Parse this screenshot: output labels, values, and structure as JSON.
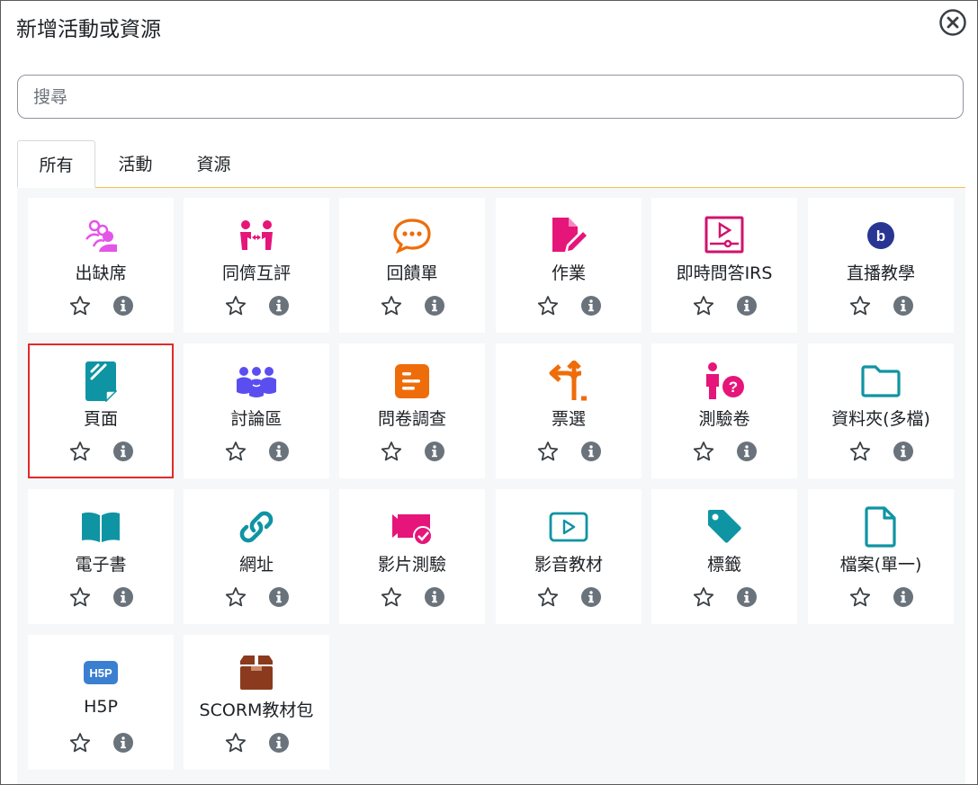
{
  "dialog": {
    "title": "新增活動或資源",
    "search_placeholder": "搜尋"
  },
  "tabs": [
    {
      "label": "所有",
      "active": true
    },
    {
      "label": "活動",
      "active": false
    },
    {
      "label": "資源",
      "active": false
    }
  ],
  "modules": [
    {
      "label": "出缺席",
      "icon": "attendance-icon",
      "color": "#e454e8"
    },
    {
      "label": "同儕互評",
      "icon": "peer-review-icon",
      "color": "#e6157a"
    },
    {
      "label": "回饋單",
      "icon": "feedback-icon",
      "color": "#ee6d0a"
    },
    {
      "label": "作業",
      "icon": "assignment-icon",
      "color": "#e6157a"
    },
    {
      "label": "即時問答IRS",
      "icon": "irs-icon",
      "color": "#d1136d"
    },
    {
      "label": "直播教學",
      "icon": "bigbluebutton-icon",
      "color": "#283593"
    },
    {
      "label": "頁面",
      "icon": "page-icon",
      "color": "#0f94a3",
      "selected": true
    },
    {
      "label": "討論區",
      "icon": "forum-icon",
      "color": "#5b4ef0"
    },
    {
      "label": "問卷調查",
      "icon": "survey-icon",
      "color": "#ee6d0a"
    },
    {
      "label": "票選",
      "icon": "choice-icon",
      "color": "#ee6d0a"
    },
    {
      "label": "測驗卷",
      "icon": "quiz-icon",
      "color": "#e6157a"
    },
    {
      "label": "資料夾(多檔)",
      "icon": "folder-icon",
      "color": "#0f94a3"
    },
    {
      "label": "電子書",
      "icon": "book-icon",
      "color": "#0f94a3"
    },
    {
      "label": "網址",
      "icon": "url-icon",
      "color": "#0f94a3"
    },
    {
      "label": "影片測驗",
      "icon": "video-quiz-icon",
      "color": "#e6157a"
    },
    {
      "label": "影音教材",
      "icon": "video-icon",
      "color": "#0f94a3"
    },
    {
      "label": "標籤",
      "icon": "label-icon",
      "color": "#0f94a3"
    },
    {
      "label": "檔案(單一)",
      "icon": "file-icon",
      "color": "#0f94a3"
    },
    {
      "label": "H5P",
      "icon": "h5p-icon",
      "color": "#3b7fd1"
    },
    {
      "label": "SCORM教材包",
      "icon": "scorm-icon",
      "color": "#8b3a1e"
    }
  ],
  "actions": {
    "star_icon": "star-icon",
    "info_icon": "info-icon"
  }
}
